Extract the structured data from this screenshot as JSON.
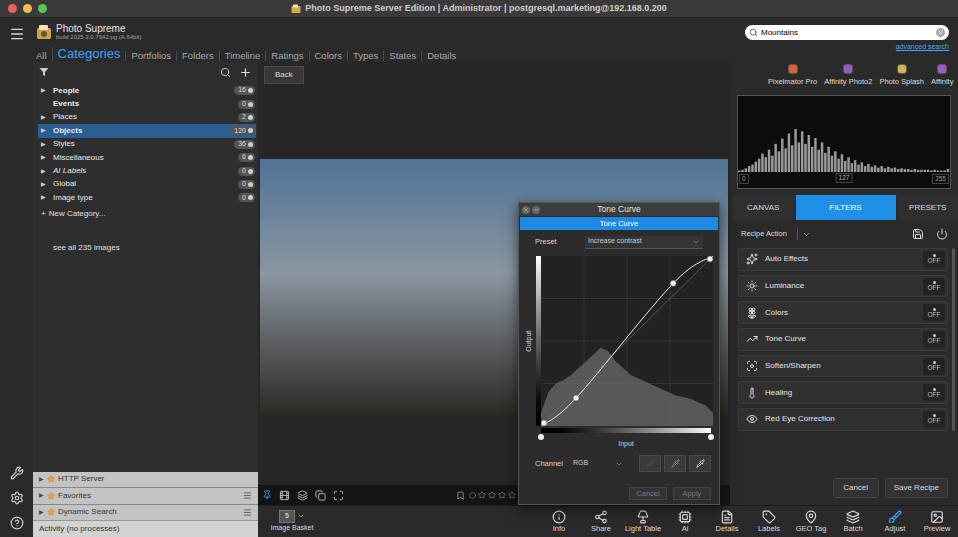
{
  "window": {
    "title": "Photo Supreme Server Edition | Administrator | postgresql.marketing@192.168.0.200"
  },
  "app": {
    "name": "Photo Supreme",
    "build": "build 2025.3.0.7942.pg (A.64bit)"
  },
  "nav_tabs": [
    {
      "label": "All",
      "selected": false
    },
    {
      "label": "Categories",
      "selected": true
    },
    {
      "label": "Portfolios",
      "selected": false
    },
    {
      "label": "Folders",
      "selected": false
    },
    {
      "label": "Timeline",
      "selected": false
    },
    {
      "label": "Ratings",
      "selected": false
    },
    {
      "label": "Colors",
      "selected": false
    },
    {
      "label": "Types",
      "selected": false
    },
    {
      "label": "States",
      "selected": false
    },
    {
      "label": "Details",
      "selected": false
    }
  ],
  "search": {
    "value": "Mountains",
    "advanced_link": "advanced search"
  },
  "external_editors": [
    {
      "label": "Pixelmator Pro",
      "color": "#e0603a"
    },
    {
      "label": "Affinity Photo2",
      "color": "#9b59d0"
    },
    {
      "label": "Photo Splash",
      "color": "#d8b34a"
    },
    {
      "label": "Affinity",
      "color": "#9b59d0"
    }
  ],
  "category_tree": {
    "expand_glyph": "▶",
    "items": [
      {
        "label": "People",
        "count": "16",
        "expandable": true,
        "selected": false,
        "italic": false,
        "bold": true
      },
      {
        "label": "Events",
        "count": "0",
        "expandable": false,
        "selected": false,
        "italic": false,
        "bold": true
      },
      {
        "label": "Places",
        "count": "2",
        "expandable": true,
        "selected": false,
        "italic": false,
        "bold": false
      },
      {
        "label": "Objects",
        "count": "120",
        "expandable": true,
        "selected": true,
        "italic": false,
        "bold": true
      },
      {
        "label": "Styles",
        "count": "36",
        "expandable": true,
        "selected": false,
        "italic": false,
        "bold": false
      },
      {
        "label": "Miscellaneous",
        "count": "6",
        "expandable": true,
        "selected": false,
        "italic": false,
        "bold": false
      },
      {
        "label": "AI Labels",
        "count": "0",
        "expandable": true,
        "selected": false,
        "italic": true,
        "bold": false
      },
      {
        "label": "Global",
        "count": "0",
        "expandable": true,
        "selected": false,
        "italic": false,
        "bold": false
      },
      {
        "label": "Image type",
        "count": "0",
        "expandable": true,
        "selected": false,
        "italic": false,
        "bold": false
      }
    ],
    "new_category": {
      "glyph": "+",
      "label": "New Category..."
    },
    "see_all": "see all 235 images"
  },
  "bottom_panels": {
    "expand_glyph": "▶",
    "items": [
      {
        "label": "HTTP Server",
        "has_menu": false
      },
      {
        "label": "Favorites",
        "has_menu": true
      },
      {
        "label": "Dynamic Search",
        "has_menu": true
      }
    ]
  },
  "status_bar": {
    "activity": "Activity (no processes)"
  },
  "viewer": {
    "back_button": "Back",
    "filmstrip": {
      "stars": 0
    }
  },
  "tone_curve_dialog": {
    "title": "Tone Curve",
    "header": "Tone Curve",
    "preset_label": "Preset",
    "preset_value": "Increase contrast",
    "output_label": "Output",
    "input_label": "Input",
    "channel_label": "Channel",
    "channel_value": "RGB",
    "curve_points": [
      [
        0,
        0
      ],
      [
        52,
        42
      ],
      [
        196,
        214
      ],
      [
        255,
        255
      ]
    ],
    "histogram": [
      8,
      20,
      25,
      27,
      30,
      34,
      38,
      42,
      46,
      44,
      38,
      34,
      30,
      28,
      26,
      24,
      22,
      20,
      18,
      17,
      16,
      14,
      12,
      8
    ],
    "buttons": [
      {
        "label": "Cancel",
        "disabled": true
      },
      {
        "label": "Apply",
        "disabled": true
      }
    ]
  },
  "histogram": {
    "values": [
      2,
      3,
      5,
      8,
      10,
      14,
      18,
      25,
      20,
      30,
      22,
      38,
      28,
      45,
      32,
      52,
      36,
      58,
      40,
      55,
      38,
      50,
      34,
      46,
      30,
      40,
      26,
      34,
      22,
      28,
      18,
      24,
      15,
      20,
      12,
      16,
      10,
      13,
      8,
      11,
      7,
      9,
      6,
      8,
      5,
      7,
      5,
      6,
      4,
      5,
      4,
      4,
      3,
      4,
      3,
      3,
      3,
      3,
      2,
      3,
      2,
      2,
      2,
      4
    ],
    "ticks": [
      "0",
      "127",
      "255"
    ],
    "level": 0.5
  },
  "adjust_tabs": [
    {
      "label": "CANVAS",
      "selected": false
    },
    {
      "label": "FILTERS",
      "selected": true
    },
    {
      "label": "PRESETS",
      "selected": false
    }
  ],
  "recipe": {
    "label": "Recipe Action"
  },
  "filters": [
    {
      "label": "Auto Effects",
      "toggle": "OFF",
      "on": false
    },
    {
      "label": "Luminance",
      "toggle": "OFF",
      "on": false
    },
    {
      "label": "Colors",
      "toggle": "OFF",
      "on": false
    },
    {
      "label": "Tone Curve",
      "toggle": "OFF",
      "on": false
    },
    {
      "label": "Soften/Sharpen",
      "toggle": "OFF",
      "on": false
    },
    {
      "label": "Healing",
      "toggle": "OFF",
      "on": false
    },
    {
      "label": "Red Eye Correction",
      "toggle": "OFF",
      "on": false
    }
  ],
  "recipe_buttons": [
    "Cancel",
    "Save Recipe"
  ],
  "toolbar": {
    "basket": {
      "label": "Image Basket",
      "count": "5"
    },
    "items": [
      {
        "label": "Info",
        "selected": false
      },
      {
        "label": "Share",
        "selected": false
      },
      {
        "label": "Light Table",
        "selected": false
      },
      {
        "label": "Ai",
        "selected": false
      },
      {
        "label": "Details",
        "selected": false
      },
      {
        "label": "Labels",
        "selected": false
      },
      {
        "label": "GEO Tag",
        "selected": false
      },
      {
        "label": "Batch",
        "selected": false
      },
      {
        "label": "Adjust",
        "selected": true
      },
      {
        "label": "Preview",
        "selected": false
      }
    ]
  }
}
